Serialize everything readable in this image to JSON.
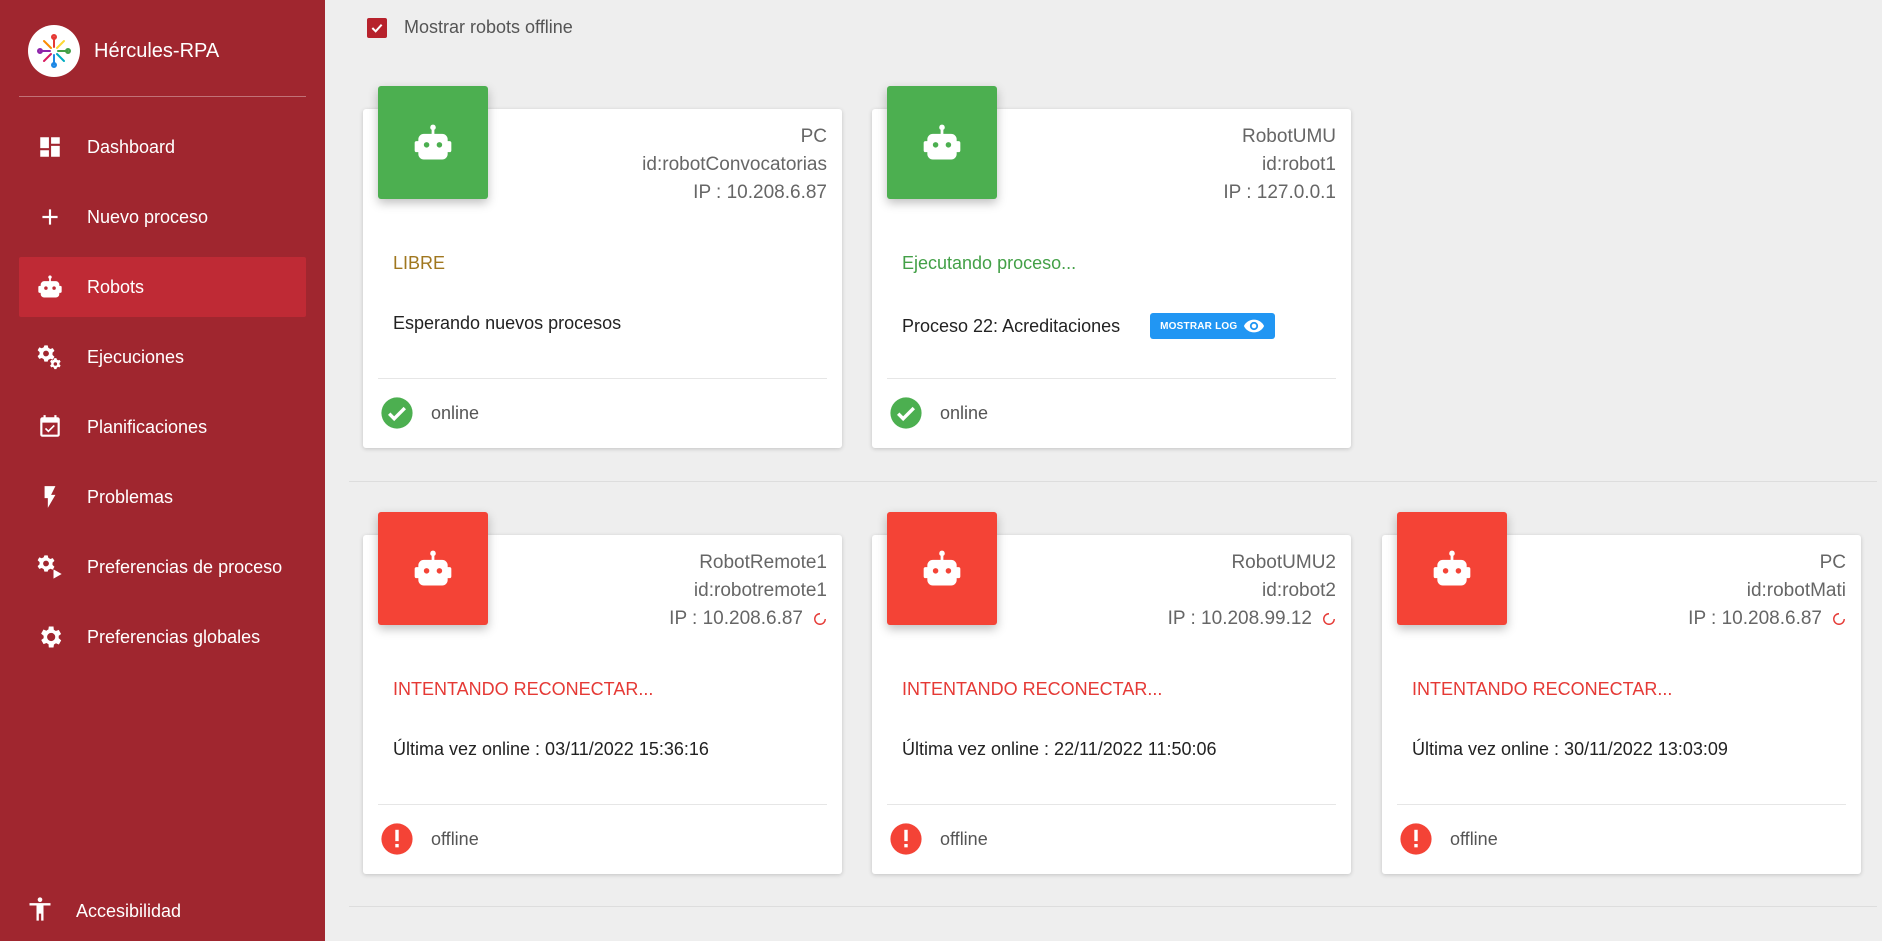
{
  "app": {
    "title": "Hércules-RPA"
  },
  "sidebar": {
    "items": [
      {
        "label": "Dashboard",
        "icon": "dashboard-icon"
      },
      {
        "label": "Nuevo proceso",
        "icon": "plus-icon"
      },
      {
        "label": "Robots",
        "icon": "robot-icon"
      },
      {
        "label": "Ejecuciones",
        "icon": "gears-icon"
      },
      {
        "label": "Planificaciones",
        "icon": "calendar-check-icon"
      },
      {
        "label": "Problemas",
        "icon": "bolt-icon"
      },
      {
        "label": "Preferencias de proceso",
        "icon": "gear-play-icon"
      },
      {
        "label": "Preferencias globales",
        "icon": "gear-icon"
      }
    ],
    "accessibility": {
      "label": "Accesibilidad",
      "icon": "accessibility-icon"
    }
  },
  "filter": {
    "show_offline_label": "Mostrar robots offline",
    "checked": true
  },
  "robots": [
    {
      "name": "PC",
      "id": "id:robotConvocatorias",
      "ip": "IP : 10.208.6.87",
      "status": "LIBRE",
      "description": "Esperando nuevos procesos",
      "connection": "online",
      "color": "#4caf50"
    },
    {
      "name": "RobotUMU",
      "id": "id:robot1",
      "ip": "IP : 127.0.0.1",
      "status": "Ejecutando proceso...",
      "description": "Proceso 22: Acreditaciones",
      "log_button": "MOSTRAR LOG",
      "connection": "online",
      "color": "#4caf50"
    },
    {
      "name": "RobotRemote1",
      "id": "id:robotremote1",
      "ip": "IP : 10.208.6.87",
      "status": "INTENTANDO RECONECTAR...",
      "description": "Última vez online : 03/11/2022 15:36:16",
      "connection": "offline",
      "color": "#f44336"
    },
    {
      "name": "RobotUMU2",
      "id": "id:robot2",
      "ip": "IP : 10.208.99.12",
      "status": "INTENTANDO RECONECTAR...",
      "description": "Última vez online : 22/11/2022 11:50:06",
      "connection": "offline",
      "color": "#f44336"
    },
    {
      "name": "PC",
      "id": "id:robotMati",
      "ip": "IP : 10.208.6.87",
      "status": "INTENTANDO RECONECTAR...",
      "description": "Última vez online : 30/11/2022 13:03:09",
      "connection": "offline",
      "color": "#f44336"
    }
  ],
  "colors": {
    "sidebar": "#a0262f",
    "sidebar_active": "#bf2a35",
    "online": "#4caf50",
    "offline": "#f44336",
    "accent_blue": "#2196f3"
  }
}
